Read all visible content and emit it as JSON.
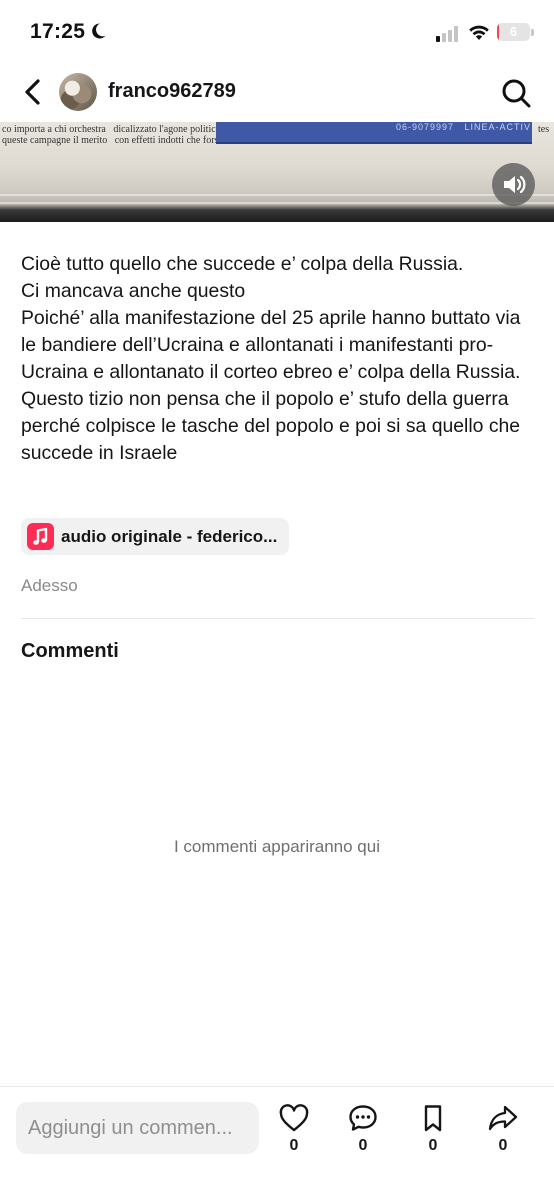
{
  "status_bar": {
    "time": "17:25",
    "battery_level": "6",
    "battery_fraction": 0.06
  },
  "header": {
    "username": "franco962789",
    "back_icon": "chevron-left-icon",
    "search_icon": "search-icon"
  },
  "media": {
    "newspaper_lines": [
      "co importa a chi orchestra   dicalizzato l'agone politico",
      "queste campagne il merito   con effetti indotti che forse"
    ],
    "band_text": "LINEA-ACTIV",
    "right_text": "tes",
    "volume_icon": "speaker-icon"
  },
  "post": {
    "caption": "Cioè tutto quello che succede e’ colpa della Russia.\nCi mancava anche questo\nPoiché’ alla manifestazione del 25 aprile hanno buttato via le bandiere dell’Ucraina e allontanati i manifestanti pro-Ucraina e allontanato il corteo ebreo e’ colpa della Russia.  Questo tizio non pensa che il popolo e’ stufo della guerra perché colpisce le tasche del popolo e poi si sa quello che succede in Israele",
    "audio_label": "audio originale - federico...",
    "timestamp": "Adesso"
  },
  "comments": {
    "title": "Commenti",
    "empty_text": "I commenti appariranno qui"
  },
  "bottom_bar": {
    "input_placeholder": "Aggiungi un commen...",
    "actions": [
      {
        "icon": "heart-icon",
        "count": "0"
      },
      {
        "icon": "comment-bubble-icon",
        "count": "0"
      },
      {
        "icon": "bookmark-icon",
        "count": "0"
      },
      {
        "icon": "share-icon",
        "count": "0"
      }
    ]
  },
  "colors": {
    "accent": "#fe2c55",
    "text": "#161616",
    "muted": "#8a8a8a",
    "battery": "#e35050"
  }
}
